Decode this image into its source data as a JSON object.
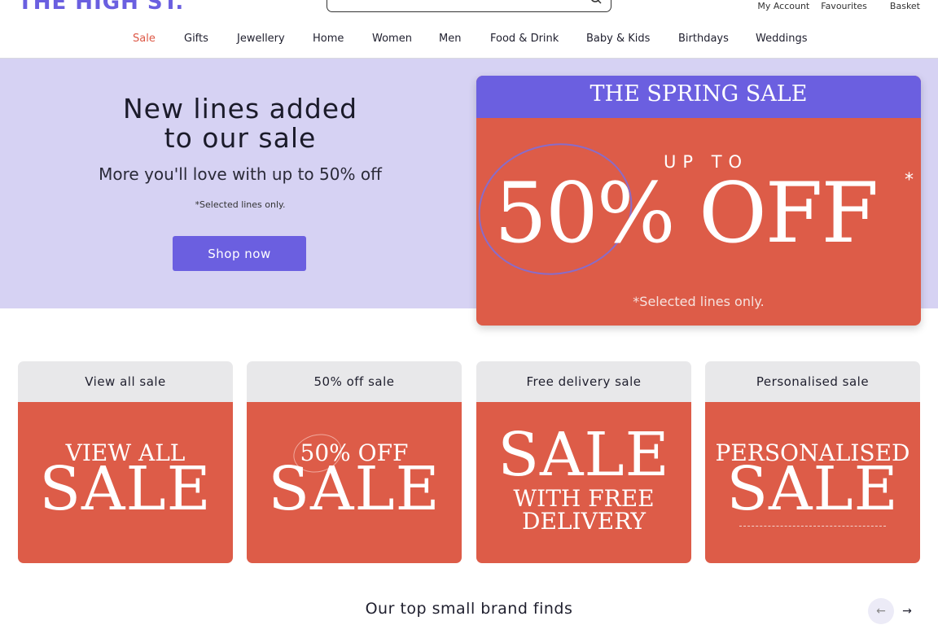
{
  "header": {
    "logo": "THE HIGH ST.",
    "search": {
      "placeholder": ""
    },
    "account": {
      "my_account": "My Account",
      "favourites": "Favourites",
      "basket": "Basket"
    }
  },
  "nav": [
    {
      "label": "Sale"
    },
    {
      "label": "Gifts"
    },
    {
      "label": "Jewellery"
    },
    {
      "label": "Home"
    },
    {
      "label": "Women"
    },
    {
      "label": "Men"
    },
    {
      "label": "Food & Drink"
    },
    {
      "label": "Baby & Kids"
    },
    {
      "label": "Birthdays"
    },
    {
      "label": "Weddings"
    }
  ],
  "hero": {
    "title_line1": "New lines added",
    "title_line2": "to our sale",
    "subtitle": "More you'll love with up to 50% off",
    "note": "*Selected lines only.",
    "button": "Shop now",
    "promo": {
      "banner": "THE SPRING SALE",
      "up_to": "UP TO",
      "big": "50% OFF",
      "star": "*",
      "note": "*Selected lines only."
    }
  },
  "cards": [
    {
      "title": "View all sale",
      "img_small": "VIEW ALL",
      "img_big": "SALE"
    },
    {
      "title": "50% off sale",
      "img_small": "50% OFF",
      "img_big": "SALE"
    },
    {
      "title": "Free delivery sale",
      "img_big": "SALE",
      "img_line1": "WITH FREE",
      "img_line2": "DELIVERY"
    },
    {
      "title": "Personalised sale",
      "img_small": "PERSONALISED",
      "img_big": "SALE"
    }
  ],
  "section": {
    "title": "Our top small brand finds"
  },
  "colors": {
    "accent": "#6b5fe0",
    "sale_red": "#dd5c48",
    "hero_bg": "#d6d2f3"
  }
}
